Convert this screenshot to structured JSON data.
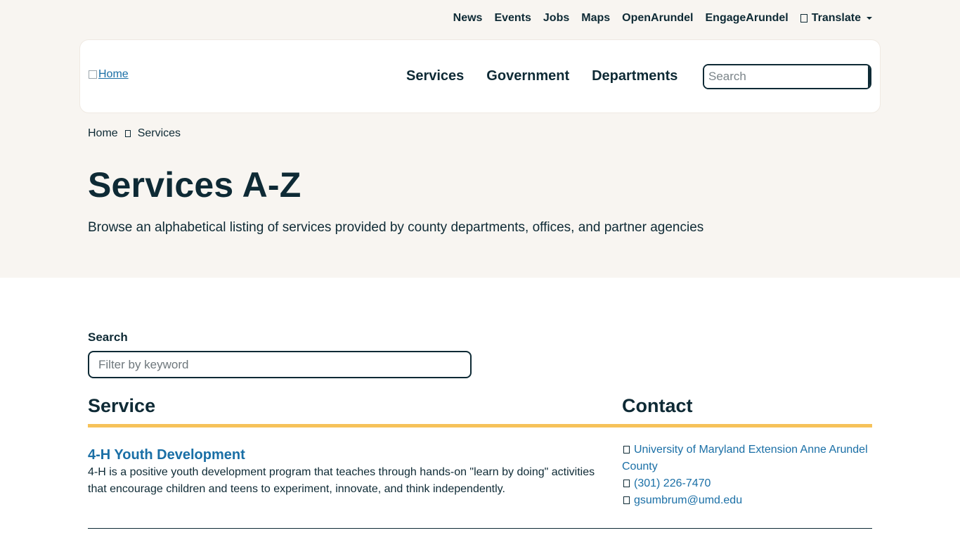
{
  "utility_nav": {
    "links": [
      "News",
      "Events",
      "Jobs",
      "Maps",
      "OpenArundel",
      "EngageArundel"
    ],
    "translate_label": "Translate"
  },
  "header": {
    "logo_alt": "Home",
    "nav": [
      "Services",
      "Government",
      "Departments"
    ],
    "search_placeholder": "Search"
  },
  "breadcrumb": [
    "Home",
    "Services"
  ],
  "page": {
    "title": "Services A-Z",
    "subtitle": "Browse an alphabetical listing of services provided by county departments, offices, and partner agencies"
  },
  "filter": {
    "label": "Search",
    "placeholder": "Filter by keyword"
  },
  "table": {
    "headers": [
      "Service",
      "Contact"
    ],
    "rows": [
      {
        "title": "4-H Youth Development",
        "description": "4-H is a positive youth development program that teaches through hands-on \"learn by doing\" activities that encourage children and teens to experiment, innovate, and think independently.",
        "contact_org": "University of Maryland Extension Anne Arundel County",
        "contact_phone": "(301) 226-7470",
        "contact_email": "gsumbrum@umd.edu"
      }
    ]
  },
  "colors": {
    "navy": "#0e2a35",
    "link": "#1a6fa6",
    "gold": "#f6c25a",
    "hero_bg": "#f8f5f1"
  }
}
